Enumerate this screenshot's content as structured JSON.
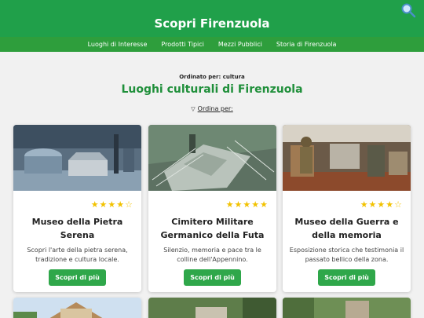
{
  "header": {
    "title": "Scopri Firenzuola",
    "search_icon": "search-icon"
  },
  "nav": [
    "Luoghi di Interesse",
    "Prodotti Tipici",
    "Mezzi Pubblici",
    "Storia di Firenzuola"
  ],
  "page": {
    "sorted_by": "Ordinato per: cultura",
    "title": "Luoghi culturali di Firenzuola",
    "order_label": "Ordina per:"
  },
  "colors": {
    "brand_green": "#20a04a",
    "nav_green": "#2e9e3c",
    "title_green": "#1f8f3a",
    "button_green": "#2fa74a",
    "star": "#f2c200"
  },
  "cards": [
    {
      "rating": 4,
      "stars": "★★★★☆",
      "title": "Museo della Pietra Serena",
      "description": "Scopri l'arte della pietra serena, tradizione e cultura locale.",
      "button": "Scopri di più"
    },
    {
      "rating": 5,
      "stars": "★★★★★",
      "title": "Cimitero Militare Germanico della Futa",
      "description": "Silenzio, memoria e pace tra le colline dell'Appennino.",
      "button": "Scopri di più"
    },
    {
      "rating": 4,
      "stars": "★★★★☆",
      "title": "Museo della Guerra e della memoria",
      "description": "Esposizione storica che testimonia il passato bellico della zona.",
      "button": "Scopri di più"
    }
  ]
}
